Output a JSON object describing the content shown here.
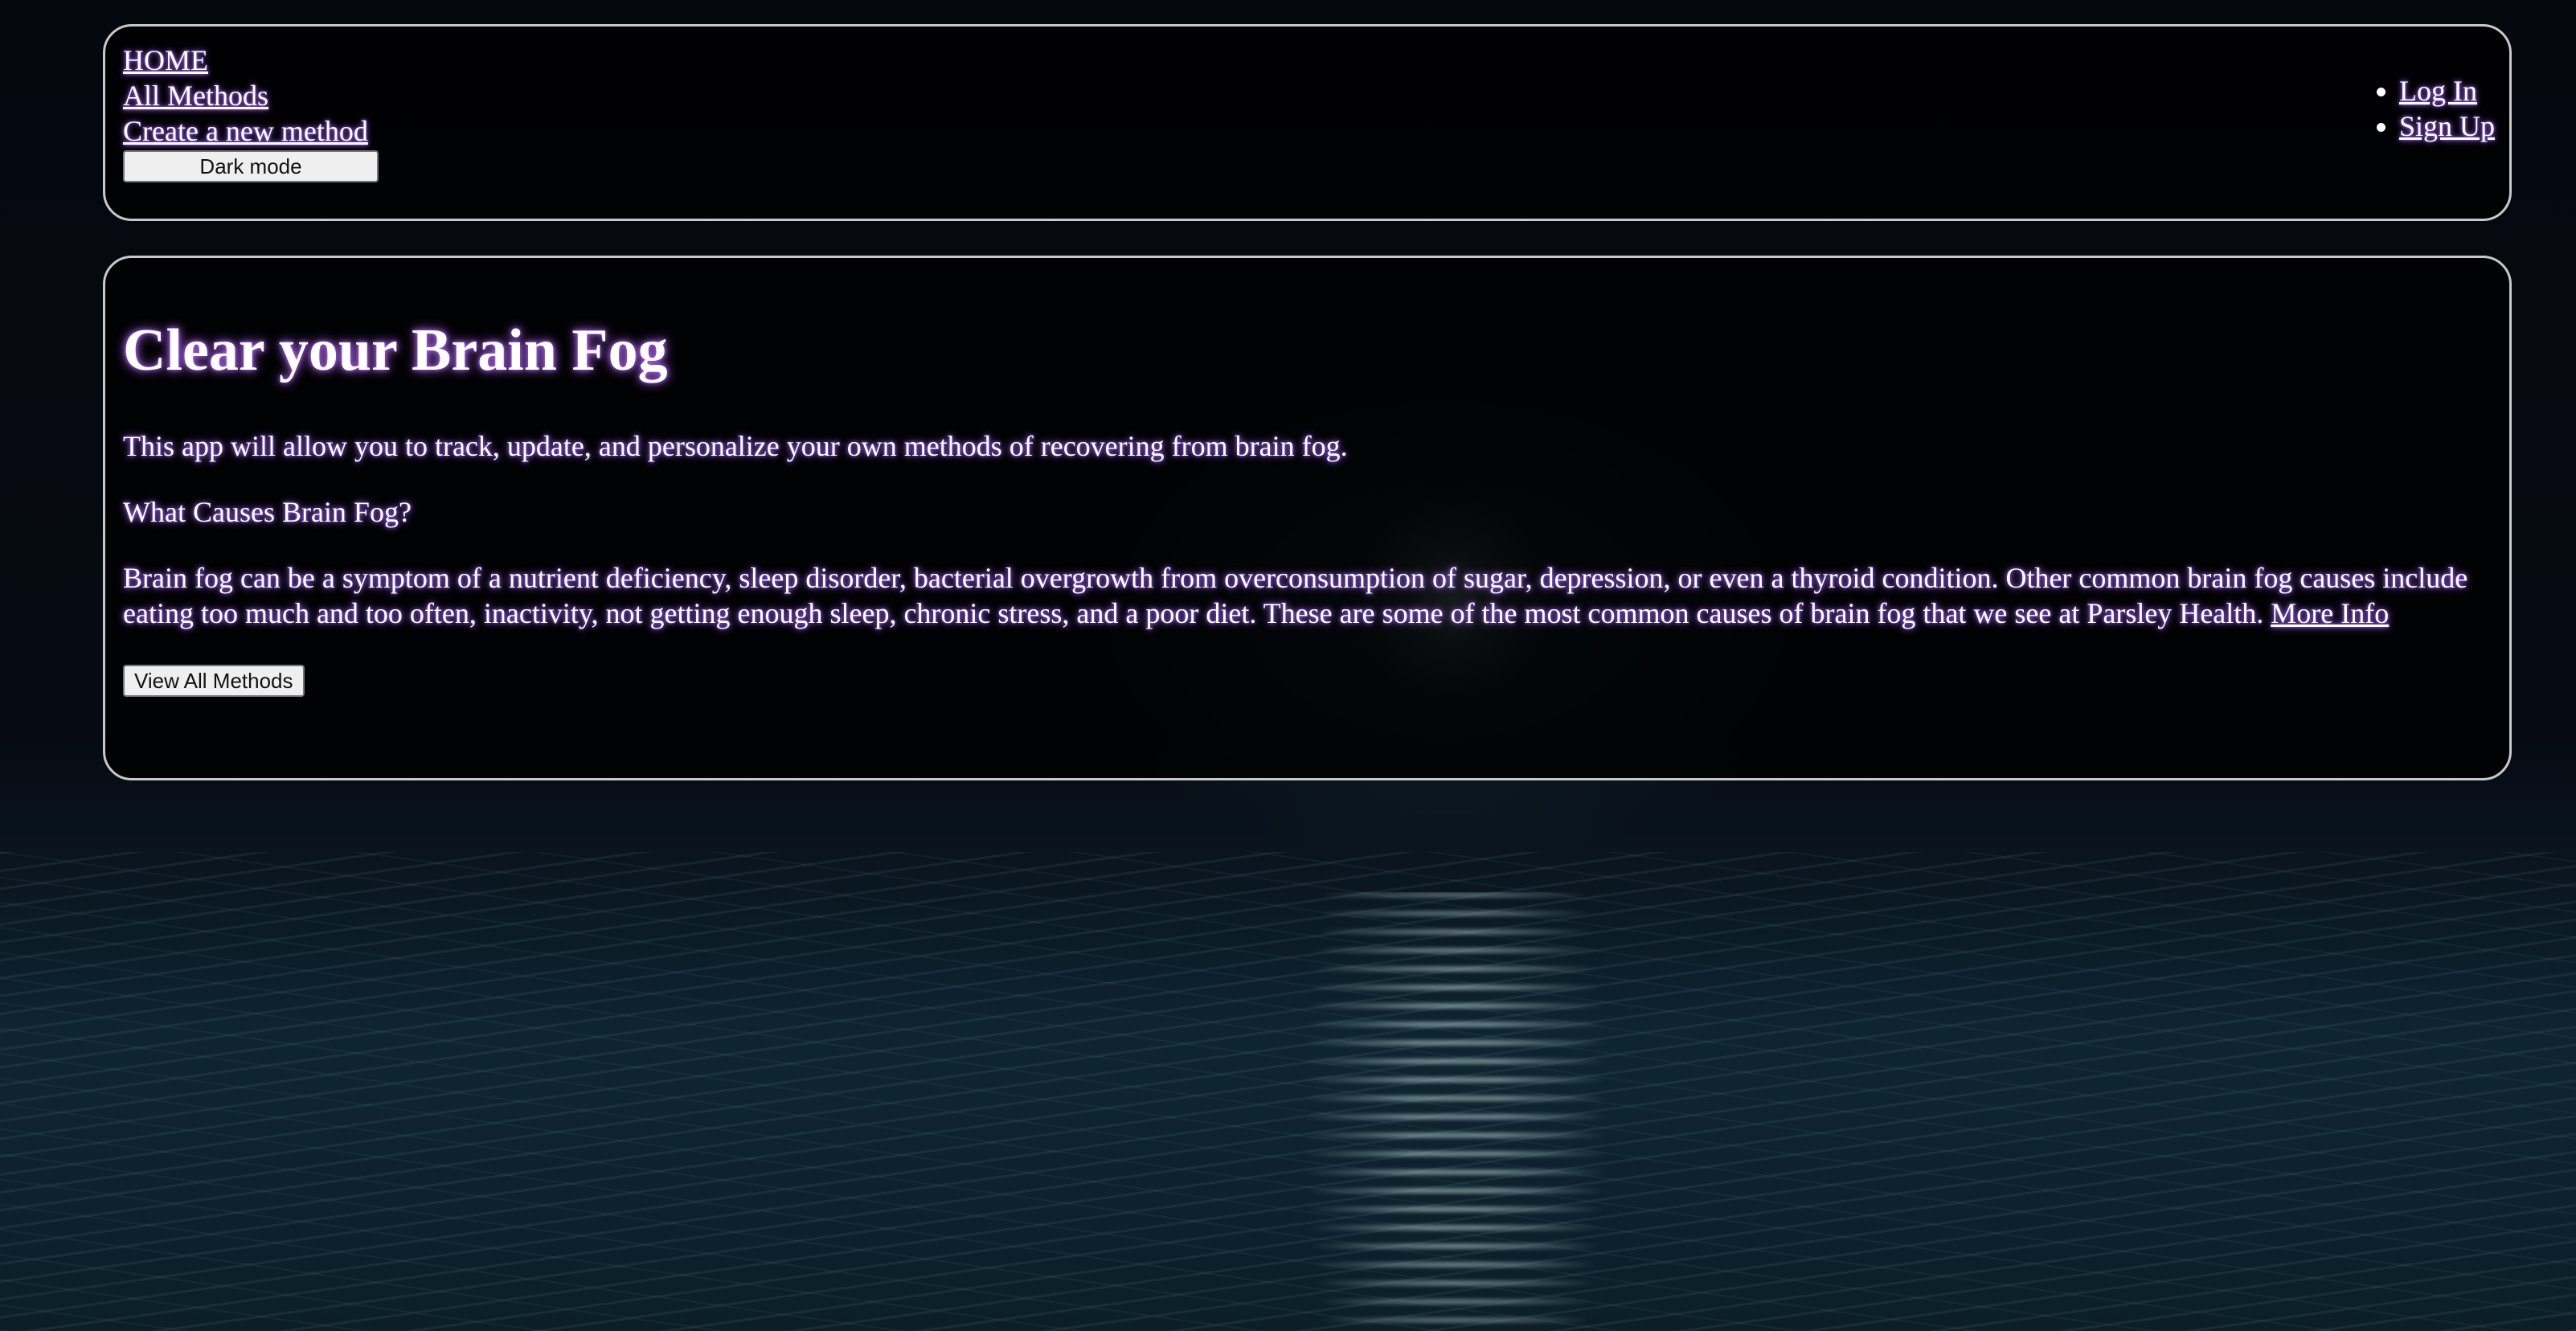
{
  "nav": {
    "links": [
      {
        "label": "HOME"
      },
      {
        "label": "All Methods"
      },
      {
        "label": "Create a new method"
      }
    ],
    "dark_mode_label": "Dark mode",
    "auth_links": [
      {
        "label": "Log In"
      },
      {
        "label": "Sign Up"
      }
    ]
  },
  "main": {
    "title": "Clear your Brain Fog",
    "intro": "This app will allow you to track, update, and personalize your own methods of recovering from brain fog.",
    "subheading": "What Causes Brain Fog?",
    "body": "Brain fog can be a symptom of a nutrient deficiency, sleep disorder, bacterial overgrowth from overconsumption of sugar, depression, or even a thyroid condition. Other common brain fog causes include eating too much and too often, inactivity, not getting enough sleep, chronic stress, and a poor diet. These are some of the most common causes of brain fog that we see at Parsley Health.",
    "more_info_label": "More Info",
    "view_all_label": "View All Methods"
  },
  "colors": {
    "panel_border": "#c8c8c8",
    "text": "#ffffff",
    "glow": "#b070ff"
  }
}
